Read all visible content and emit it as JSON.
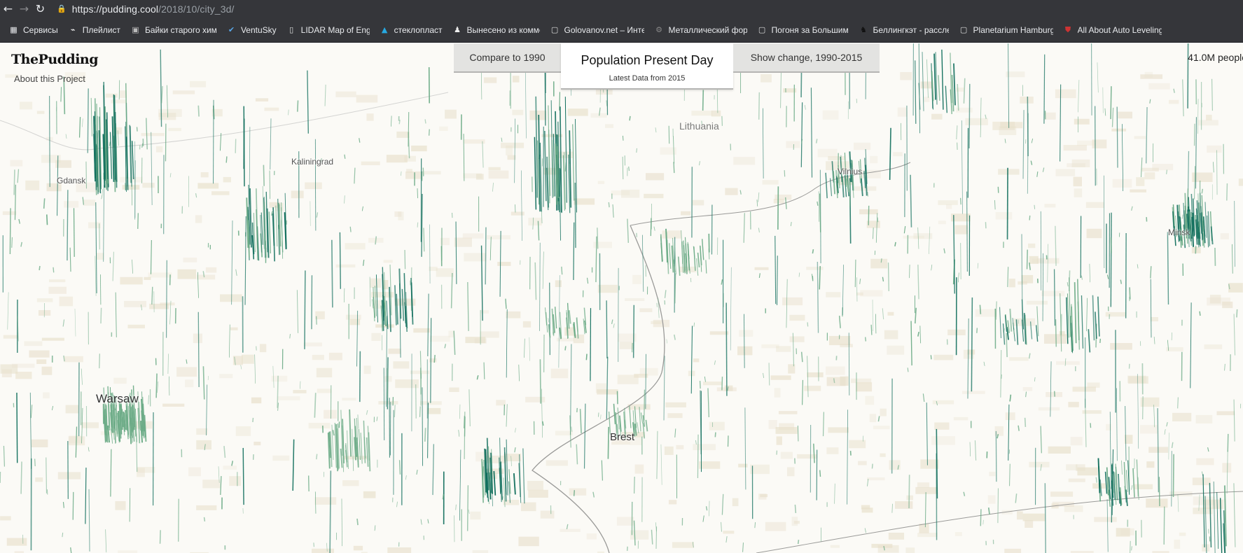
{
  "browser": {
    "url_host": "https://pudding.cool",
    "url_path": "/2018/10/city_3d/",
    "bookmarks": [
      {
        "label": "Сервисы",
        "icon": "apps-grid-icon"
      },
      {
        "label": "Плейлист",
        "icon": "playlist-icon"
      },
      {
        "label": "Байки старого химика",
        "icon": "image-icon"
      },
      {
        "label": "VentuSky",
        "icon": "ventusky-icon"
      },
      {
        "label": "LIDAR Map of England",
        "icon": "lidar-icon"
      },
      {
        "label": "стеклопласт",
        "icon": "triangle-icon"
      },
      {
        "label": "Вынесено из комментариев",
        "icon": "person-icon"
      },
      {
        "label": "Golovanov.net – Интернет",
        "icon": "page-icon"
      },
      {
        "label": "Металлический форум",
        "icon": "gear-icon"
      },
      {
        "label": "Погоня за Большим",
        "icon": "page-icon"
      },
      {
        "label": "Беллингкэт - расследования",
        "icon": "bellingcat-icon"
      },
      {
        "label": "Planetarium Hamburg",
        "icon": "page-icon"
      },
      {
        "label": "All About Auto Leveling",
        "icon": "shield-icon"
      }
    ]
  },
  "site": {
    "logo": "ThePudding",
    "about": "About this Project",
    "population": "41.0M people"
  },
  "tabs": {
    "left": "Compare to 1990",
    "main_title": "Population Present Day",
    "main_sub": "Latest Data from 2015",
    "right": "Show change, 1990-2015"
  },
  "map_labels": {
    "gdansk": "Gdansk",
    "kaliningrad": "Kaliningrad",
    "lithuania": "Lithuania",
    "vilnius": "Vilnius",
    "minsk": "Minsk",
    "warsaw": "Warsaw",
    "brest": "Brest"
  },
  "colors": {
    "spike_dark": "#0f6e5c",
    "spike_light": "#6bab86",
    "ground": "#e8e0cc",
    "border": "#9a9a98"
  }
}
